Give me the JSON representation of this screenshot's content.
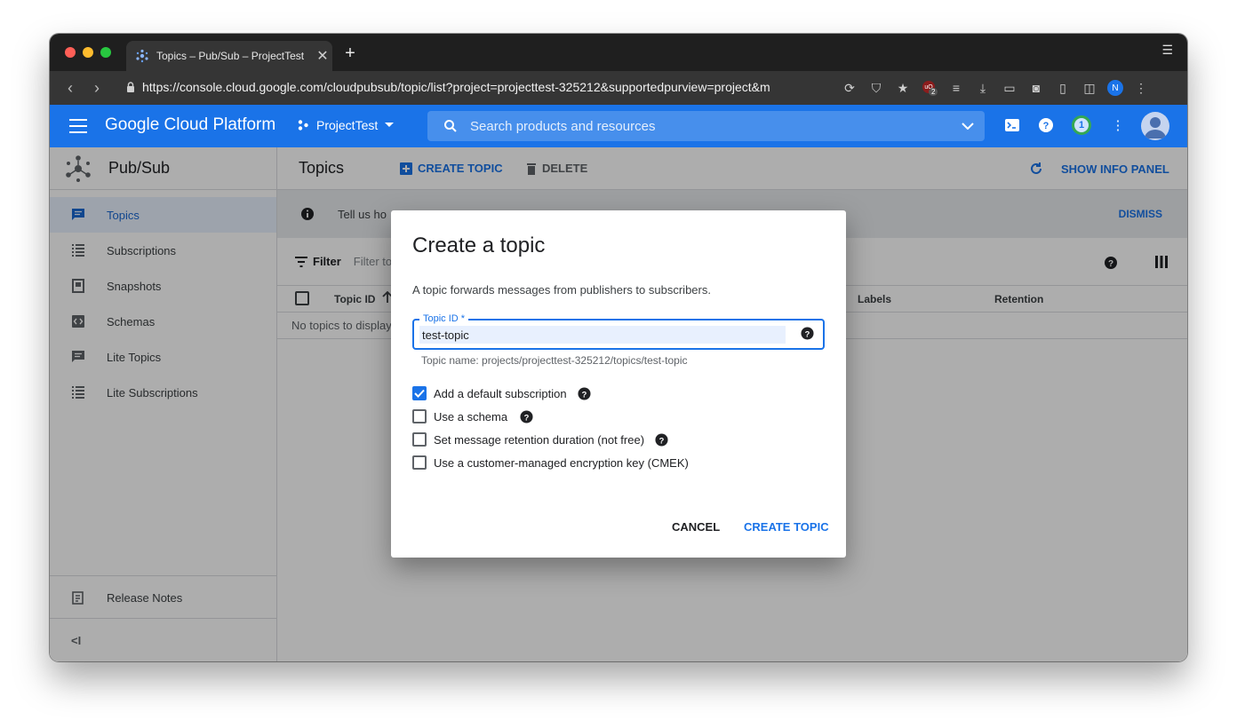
{
  "browser": {
    "tab_title": "Topics – Pub/Sub – ProjectTest",
    "tab_close": "✕",
    "new_tab": "+",
    "url": "https://console.cloud.google.com/cloudpubsub/topic/list?project=projecttest-325212&supportedpurview=project&m",
    "profile_initial": "N",
    "extension_badge": "2"
  },
  "header": {
    "brand": "Google Cloud Platform",
    "project": "ProjectTest",
    "search_placeholder": "Search products and resources",
    "notifications_count": "1"
  },
  "sidebar": {
    "product": "Pub/Sub",
    "items": [
      {
        "label": "Topics",
        "icon": "message-icon",
        "active": true
      },
      {
        "label": "Subscriptions",
        "icon": "list-icon",
        "active": false
      },
      {
        "label": "Snapshots",
        "icon": "snapshot-icon",
        "active": false
      },
      {
        "label": "Schemas",
        "icon": "code-icon",
        "active": false
      },
      {
        "label": "Lite Topics",
        "icon": "message-icon",
        "active": false
      },
      {
        "label": "Lite Subscriptions",
        "icon": "list-icon",
        "active": false
      }
    ],
    "release_notes": "Release Notes",
    "collapse_glyph": "<I"
  },
  "main": {
    "title": "Topics",
    "create_topic": "CREATE TOPIC",
    "delete": "DELETE",
    "show_info_panel": "SHOW INFO PANEL",
    "banner_text": "Tell us ho",
    "dismiss": "DISMISS",
    "filter_label": "Filter",
    "filter_placeholder": "Filter to",
    "columns": [
      "Topic ID",
      "Labels",
      "Retention"
    ],
    "empty_text": "No topics to display"
  },
  "dialog": {
    "title": "Create a topic",
    "description": "A topic forwards messages from publishers to subscribers.",
    "field_label": "Topic ID *",
    "field_value": "test-topic",
    "hint": "Topic name: projects/projecttest-325212/topics/test-topic",
    "options": [
      {
        "label": "Add a default subscription",
        "checked": true,
        "help": true
      },
      {
        "label": "Use a schema",
        "checked": false,
        "help": true
      },
      {
        "label": "Set message retention duration (not free)",
        "checked": false,
        "help": true
      },
      {
        "label": "Use a customer-managed encryption key (CMEK)",
        "checked": false,
        "help": false
      }
    ],
    "cancel": "CANCEL",
    "create": "CREATE TOPIC"
  },
  "colors": {
    "brand_blue": "#1a73e8",
    "active_nav_bg": "#e8f0fe",
    "scrim": "rgba(0,0,0,0.32)"
  }
}
